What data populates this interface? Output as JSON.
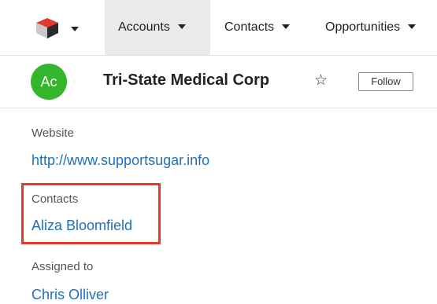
{
  "nav": {
    "items": [
      {
        "label": "Accounts"
      },
      {
        "label": "Contacts"
      },
      {
        "label": "Opportunities"
      }
    ]
  },
  "record": {
    "avatar_text": "Ac",
    "avatar_color": "#33b52c",
    "name": "Tri-State Medical Corp",
    "follow_label": "Follow"
  },
  "fields": {
    "website": {
      "label": "Website",
      "value": "http://www.supportsugar.info"
    },
    "contacts": {
      "label": "Contacts",
      "value": "Aliza Bloomfield"
    },
    "assigned": {
      "label": "Assigned to",
      "value": "Chris Olliver"
    }
  },
  "highlight_color": "#e8392a"
}
